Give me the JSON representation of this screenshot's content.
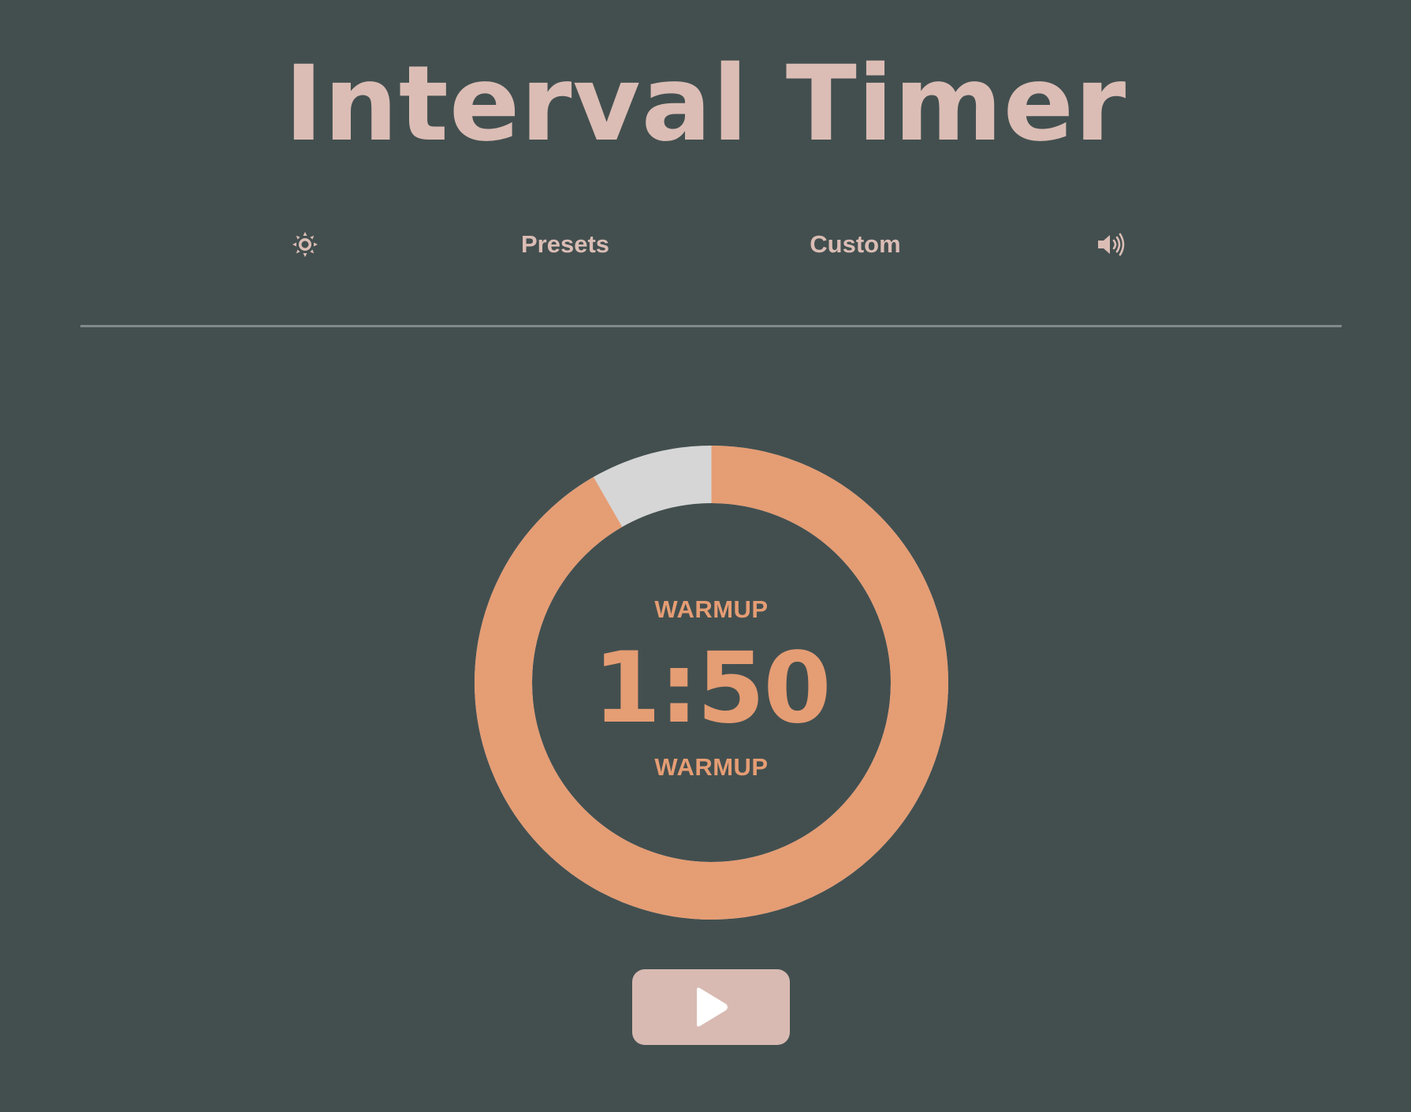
{
  "app": {
    "title": "Interval Timer"
  },
  "nav": {
    "theme_icon": "sun-icon",
    "presets_label": "Presets",
    "custom_label": "Custom",
    "sound_icon": "volume-icon"
  },
  "timer": {
    "phase_top": "WARMUP",
    "time": "1:50",
    "phase_bottom": "WARMUP",
    "progress_remaining_fraction": 0.917,
    "play_icon": "play-icon"
  },
  "colors": {
    "background": "#434f4f",
    "title": "#dbbdb5",
    "accent": "#e59d74",
    "ring_elapsed": "#d6d6d6",
    "button": "#d8bab2"
  }
}
